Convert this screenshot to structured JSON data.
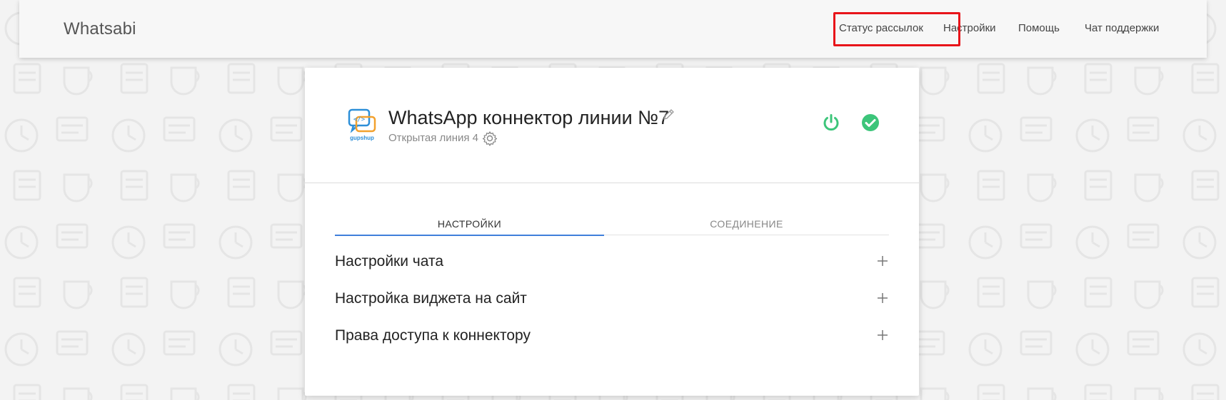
{
  "brand": "Whatsabi",
  "nav": {
    "status": "Статус рассылок",
    "settings": "Настройки",
    "help": "Помощь",
    "support": "Чат поддержки"
  },
  "connector": {
    "title": "WhatsApp коннектор линии №7",
    "subtitle": "Открытая линия 4",
    "logo_text": "gupshup"
  },
  "tabs": {
    "settings": "НАСТРОЙКИ",
    "connection": "СОЕДИНЕНИЕ"
  },
  "accordion": [
    {
      "label": "Настройки чата"
    },
    {
      "label": "Настройка виджета на сайт"
    },
    {
      "label": "Права доступа к коннектору"
    }
  ],
  "colors": {
    "highlight": "#e8141a",
    "status_green": "#3cc57a",
    "tab_underline": "#3f7fdb"
  }
}
